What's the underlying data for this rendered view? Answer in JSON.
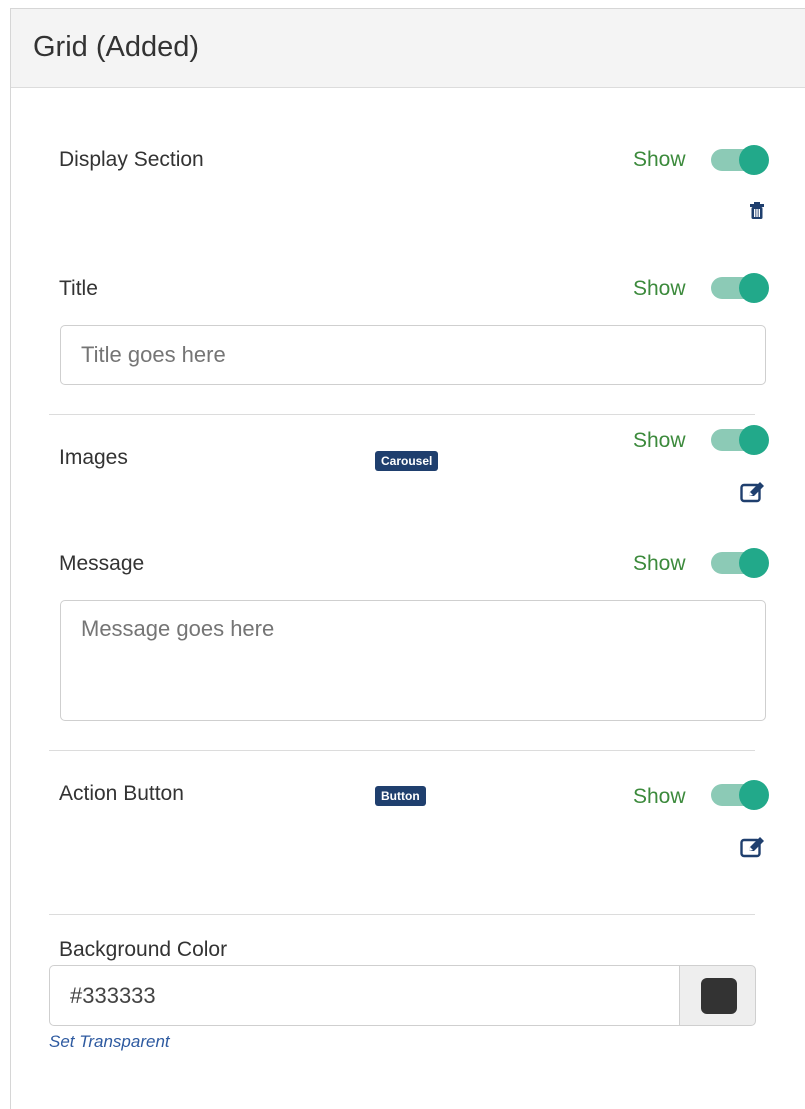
{
  "panel": {
    "title": "Grid (Added)"
  },
  "sections": {
    "display": {
      "label": "Display Section",
      "show_label": "Show",
      "enabled": true
    },
    "title": {
      "label": "Title",
      "show_label": "Show",
      "enabled": true,
      "placeholder": "Title goes here",
      "value": ""
    },
    "images": {
      "label": "Images",
      "badge": "Carousel",
      "show_label": "Show",
      "enabled": true
    },
    "message": {
      "label": "Message",
      "show_label": "Show",
      "enabled": true,
      "placeholder": "Message goes here",
      "value": ""
    },
    "action_button": {
      "label": "Action Button",
      "badge": "Button",
      "show_label": "Show",
      "enabled": true
    },
    "background_color": {
      "label": "Background Color",
      "value": "#333333",
      "swatch": "#333333",
      "set_transparent_label": "Set Transparent"
    }
  },
  "colors": {
    "accent": "#22a98a",
    "show_text": "#3c8a3c",
    "badge": "#1f3f6e",
    "link": "#2e5aa0"
  },
  "icons": {
    "delete": "trash-icon",
    "edit": "edit-icon"
  }
}
